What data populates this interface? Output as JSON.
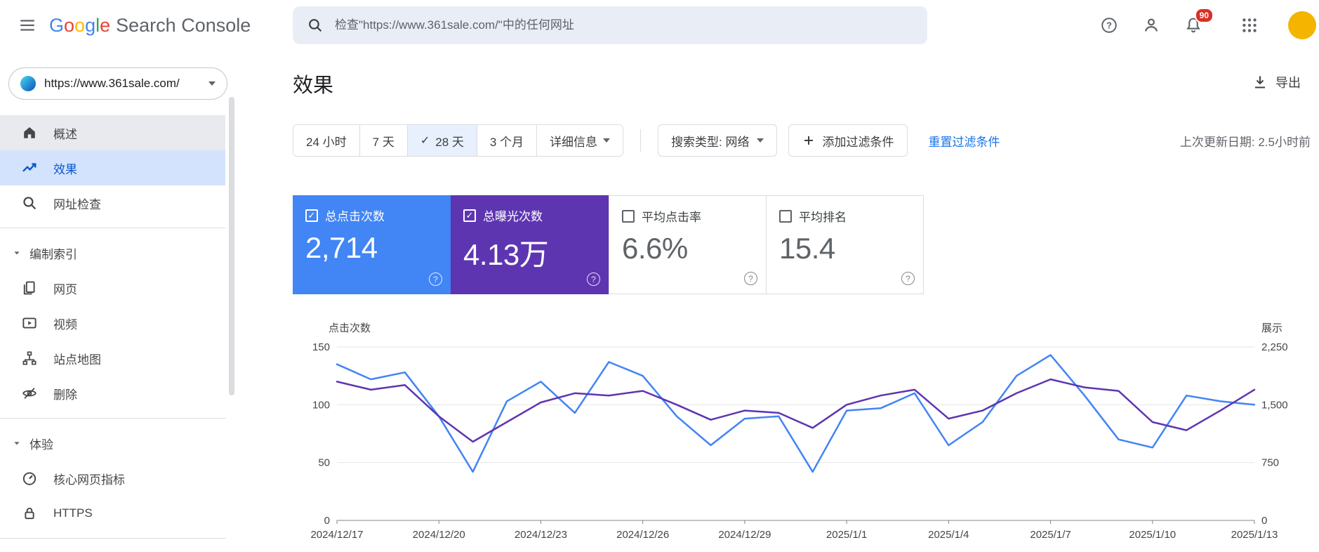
{
  "topbar": {
    "google_letters": [
      "G",
      "o",
      "o",
      "g",
      "l",
      "e"
    ],
    "product_suffix": "Search Console",
    "search_placeholder": "检查\"https://www.361sale.com/\"中的任何网址",
    "notification_count": "90"
  },
  "sidebar": {
    "property_url": "https://www.361sale.com/",
    "items": [
      {
        "label": "概述"
      },
      {
        "label": "效果"
      },
      {
        "label": "网址检查"
      },
      {
        "label": "编制索引"
      },
      {
        "label": "网页"
      },
      {
        "label": "视频"
      },
      {
        "label": "站点地图"
      },
      {
        "label": "删除"
      },
      {
        "label": "体验"
      },
      {
        "label": "核心网页指标"
      },
      {
        "label": "HTTPS"
      }
    ]
  },
  "main": {
    "title": "效果",
    "export_label": "导出",
    "filters": {
      "range_24h": "24 小时",
      "range_7d": "7 天",
      "range_28d": "28 天",
      "range_3m": "3 个月",
      "details": "详细信息",
      "search_type": "搜索类型: 网络",
      "add_filter": "添加过滤条件",
      "reset": "重置过滤条件",
      "last_updated": "上次更新日期: 2.5小时前"
    },
    "cards": [
      {
        "label": "总点击次数",
        "value": "2,714",
        "checked": true,
        "color": "#4285f4"
      },
      {
        "label": "总曝光次数",
        "value": "4.13万",
        "checked": true,
        "color": "#5e35b1"
      },
      {
        "label": "平均点击率",
        "value": "6.6%",
        "checked": false
      },
      {
        "label": "平均排名",
        "value": "15.4",
        "checked": false
      }
    ]
  },
  "chart_data": {
    "type": "line",
    "x": [
      "2024/12/17",
      "2024/12/18",
      "2024/12/19",
      "2024/12/20",
      "2024/12/21",
      "2024/12/22",
      "2024/12/23",
      "2024/12/24",
      "2024/12/25",
      "2024/12/26",
      "2024/12/27",
      "2024/12/28",
      "2024/12/29",
      "2024/12/30",
      "2024/12/31",
      "2025/1/1",
      "2025/1/2",
      "2025/1/3",
      "2025/1/4",
      "2025/1/5",
      "2025/1/6",
      "2025/1/7",
      "2025/1/8",
      "2025/1/9",
      "2025/1/10",
      "2025/1/11",
      "2025/1/12",
      "2025/1/13"
    ],
    "x_tick_labels": [
      "2024/12/17",
      "2024/12/20",
      "2024/12/23",
      "2024/12/26",
      "2024/12/29",
      "2025/1/1",
      "2025/1/4",
      "2025/1/7",
      "2025/1/10",
      "2025/1/13"
    ],
    "series": [
      {
        "name": "点击次数",
        "axis": "left",
        "color": "#4285f4",
        "values": [
          135,
          122,
          128,
          90,
          42,
          103,
          120,
          93,
          137,
          125,
          90,
          65,
          88,
          90,
          42,
          95,
          97,
          110,
          65,
          85,
          125,
          143,
          108,
          70,
          63,
          108,
          103,
          100
        ]
      },
      {
        "name": "展示",
        "axis": "right",
        "color": "#5e35b1",
        "values": [
          1800,
          1695,
          1755,
          1350,
          1020,
          1275,
          1530,
          1650,
          1620,
          1680,
          1500,
          1305,
          1425,
          1395,
          1200,
          1500,
          1620,
          1695,
          1320,
          1425,
          1650,
          1830,
          1725,
          1680,
          1275,
          1170,
          1425,
          1695
        ]
      }
    ],
    "left_axis": {
      "label": "点击次数",
      "ticks": [
        0,
        50,
        100,
        150
      ],
      "max": 150
    },
    "right_axis": {
      "label": "展示",
      "ticks": [
        "0",
        "750",
        "1,500",
        "2,250"
      ],
      "tick_values": [
        0,
        750,
        1500,
        2250
      ],
      "max": 2250
    },
    "grid": true,
    "legend_position": "none"
  }
}
